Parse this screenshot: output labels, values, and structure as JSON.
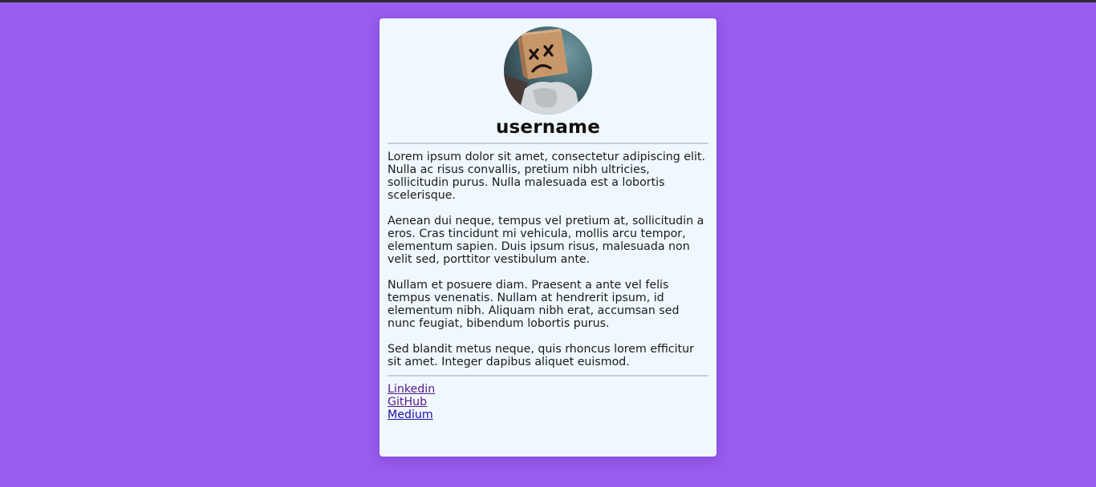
{
  "profile": {
    "username": "username",
    "avatar_alt": "profile picture"
  },
  "bio": {
    "paragraphs": [
      "Lorem ipsum dolor sit amet, consectetur adipiscing elit. Nulla ac risus convallis, pretium nibh ultricies, sollicitudin purus. Nulla malesuada est a lobortis scelerisque.",
      "Aenean dui neque, tempus vel pretium at, sollicitudin a eros. Cras tincidunt mi vehicula, mollis arcu tempor, elementum sapien. Duis ipsum risus, malesuada non velit sed, porttitor vestibulum ante.",
      "Nullam et posuere diam. Praesent a ante vel felis tempus venenatis. Nullam at hendrerit ipsum, id elementum nibh. Aliquam nibh erat, accumsan sed nunc feugiat, bibendum lobortis purus.",
      "Sed blandit metus neque, quis rhoncus lorem efficitur sit amet. Integer dapibus aliquet euismod."
    ]
  },
  "links": [
    {
      "label": "Linkedin"
    },
    {
      "label": "GitHub"
    },
    {
      "label": "Medium"
    }
  ],
  "colors": {
    "page_background": "#9a5cef",
    "card_background": "#f0f8ff",
    "divider": "#c8cdd2",
    "visited_link": "#551a8b",
    "link": "#1a0dab"
  }
}
